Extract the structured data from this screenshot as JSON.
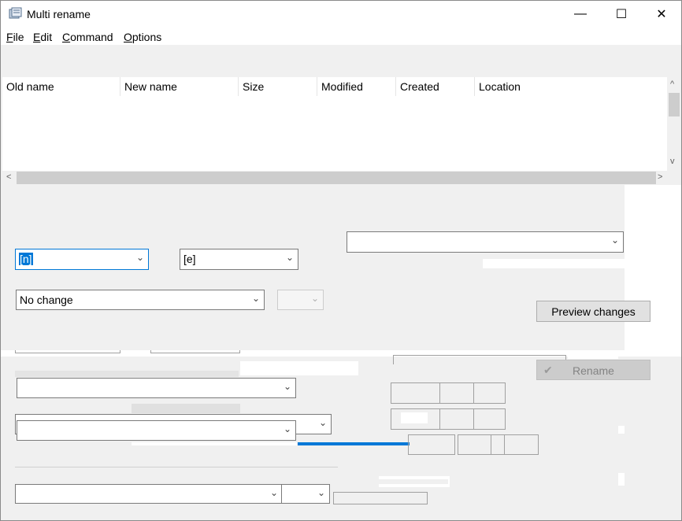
{
  "window": {
    "title": "Multi rename",
    "minimize": "—",
    "maximize": "☐",
    "close": "✕"
  },
  "menu": [
    "File",
    "Edit",
    "Command",
    "Options"
  ],
  "list": {
    "columns": [
      "Old name",
      "New name",
      "Size",
      "Modified",
      "Created",
      "Location"
    ]
  },
  "controls": {
    "name_mask": "[n]",
    "ext_mask": "[e]",
    "case_option": "No change",
    "preview_button": "Preview changes",
    "rename_button": "Rename"
  },
  "icons": {
    "app": "multi-rename-icon",
    "check": "✔",
    "chevron": "⌄",
    "arrow_left": "<",
    "arrow_right": ">",
    "arrow_up": "^",
    "arrow_down": "v"
  }
}
